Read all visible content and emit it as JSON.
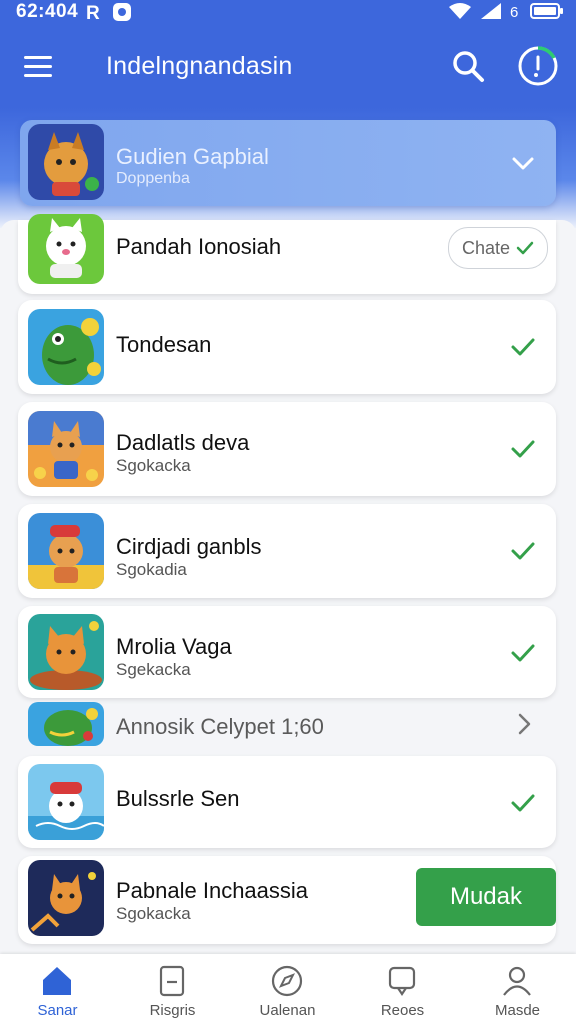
{
  "status": {
    "time": "62:404"
  },
  "app_bar": {
    "title": "Indelngnandasin"
  },
  "header": {
    "title": "Gudien Gapbial",
    "subtitle": "Doppenba"
  },
  "items": [
    {
      "title": "Pandah Ionosiah",
      "subtitle": "",
      "chip_label": "Chate"
    },
    {
      "title": "Tondesan",
      "subtitle": ""
    },
    {
      "title": "Dadlatls deva",
      "subtitle": "Sgokacka"
    },
    {
      "title": "Cirdjadi ganbls",
      "subtitle": "Sgokadia"
    },
    {
      "title": "Mrolia Vaga",
      "subtitle": "Sgekacka"
    },
    {
      "title": "Bulssrle Sen",
      "subtitle": ""
    },
    {
      "title": "Pabnale Inchaassia",
      "subtitle": "Sgokacka",
      "button_label": "Mudak"
    }
  ],
  "promo": {
    "label": "Annosik Celypet  1;60"
  },
  "bottom_nav": [
    {
      "label": "Sanar",
      "icon": "home-icon",
      "active": true
    },
    {
      "label": "Risgris",
      "icon": "document-icon",
      "active": false
    },
    {
      "label": "Ualenan",
      "icon": "compass-icon",
      "active": false
    },
    {
      "label": "Reoes",
      "icon": "chat-icon",
      "active": false
    },
    {
      "label": "Masde",
      "icon": "profile-icon",
      "active": false
    }
  ],
  "colors": {
    "primary": "#3d67dc",
    "accent_green": "#34a04a",
    "check_green": "#34a04a",
    "nav_active": "#2f63d6"
  }
}
